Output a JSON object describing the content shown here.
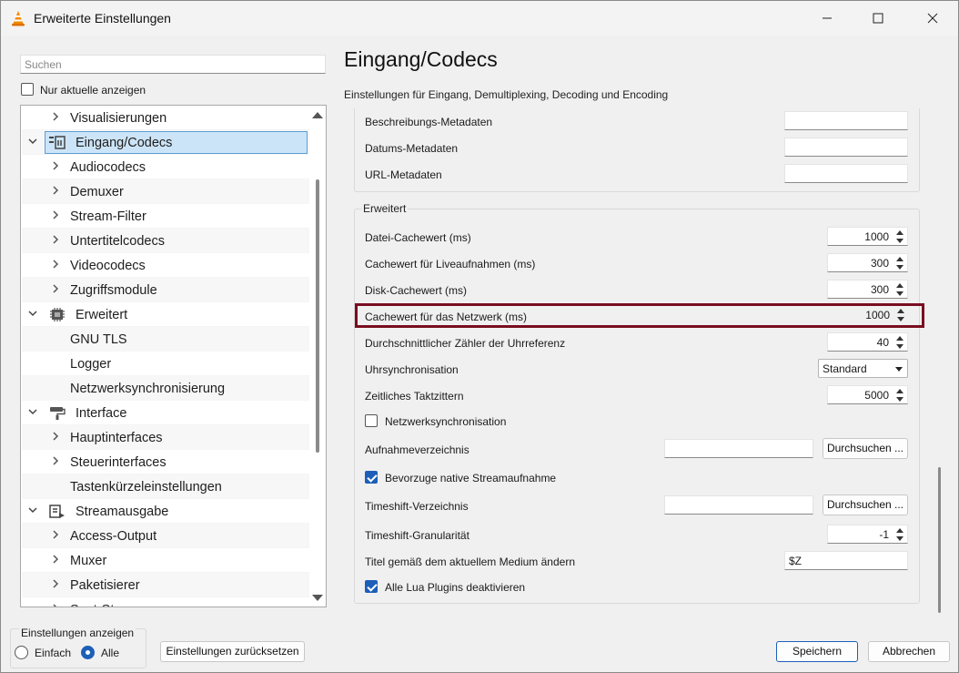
{
  "window": {
    "title": "Erweiterte Einstellungen"
  },
  "sidebar": {
    "search_placeholder": "Suchen",
    "only_current_label": "Nur aktuelle anzeigen",
    "only_current_checked": false,
    "tree": [
      {
        "label": "Visualisierungen",
        "level": 1,
        "expander": "collapsed"
      },
      {
        "label": "Eingang/Codecs",
        "level": 0,
        "expander": "expanded",
        "icon": "codec-icon",
        "selected": true
      },
      {
        "label": "Audiocodecs",
        "level": 1,
        "expander": "collapsed"
      },
      {
        "label": "Demuxer",
        "level": 1,
        "expander": "collapsed"
      },
      {
        "label": "Stream-Filter",
        "level": 1,
        "expander": "collapsed"
      },
      {
        "label": "Untertitelcodecs",
        "level": 1,
        "expander": "collapsed"
      },
      {
        "label": "Videocodecs",
        "level": 1,
        "expander": "collapsed"
      },
      {
        "label": "Zugriffsmodule",
        "level": 1,
        "expander": "collapsed"
      },
      {
        "label": "Erweitert",
        "level": 0,
        "expander": "expanded",
        "icon": "chip-icon"
      },
      {
        "label": "GNU TLS",
        "level": 1,
        "expander": "none"
      },
      {
        "label": "Logger",
        "level": 1,
        "expander": "none"
      },
      {
        "label": "Netzwerksynchronisierung",
        "level": 1,
        "expander": "none"
      },
      {
        "label": "Interface",
        "level": 0,
        "expander": "expanded",
        "icon": "paint-roller-icon"
      },
      {
        "label": "Hauptinterfaces",
        "level": 1,
        "expander": "collapsed"
      },
      {
        "label": "Steuerinterfaces",
        "level": 1,
        "expander": "collapsed"
      },
      {
        "label": "Tastenkürzeleinstellungen",
        "level": 1,
        "expander": "none"
      },
      {
        "label": "Streamausgabe",
        "level": 0,
        "expander": "expanded",
        "icon": "stream-output-icon"
      },
      {
        "label": "Access-Output",
        "level": 1,
        "expander": "collapsed"
      },
      {
        "label": "Muxer",
        "level": 1,
        "expander": "collapsed"
      },
      {
        "label": "Paketisierer",
        "level": 1,
        "expander": "collapsed"
      },
      {
        "label": "Sout-Stream",
        "level": 1,
        "expander": "collapsed"
      }
    ]
  },
  "main": {
    "title": "Eingang/Codecs",
    "description": "Einstellungen für Eingang, Demultiplexing, Decoding und Encoding",
    "metadata_rows": [
      {
        "label": "Beschreibungs-Metadaten",
        "value": ""
      },
      {
        "label": "Datums-Metadaten",
        "value": ""
      },
      {
        "label": "URL-Metadaten",
        "value": ""
      }
    ],
    "advanced_group_title": "Erweitert",
    "advanced": {
      "file_cache": {
        "label": "Datei-Cachewert (ms)",
        "value": "1000"
      },
      "live_cache": {
        "label": "Cachewert für Liveaufnahmen (ms)",
        "value": "300"
      },
      "disc_cache": {
        "label": "Disk-Cachewert (ms)",
        "value": "300"
      },
      "network_cache": {
        "label": "Cachewert für das Netzwerk (ms)",
        "value": "1000"
      },
      "clock_ref": {
        "label": "Durchschnittlicher Zähler der Uhrreferenz",
        "value": "40"
      },
      "clock_sync": {
        "label": "Uhrsynchronisation",
        "value": "Standard"
      },
      "clock_jitter": {
        "label": "Zeitliches Taktzittern",
        "value": "5000"
      },
      "netsync": {
        "label": "Netzwerksynchronisation",
        "checked": false
      },
      "record_dir": {
        "label": "Aufnahmeverzeichnis",
        "value": "",
        "browse": "Durchsuchen ..."
      },
      "native_record": {
        "label": "Bevorzuge native Streamaufnahme",
        "checked": true
      },
      "timeshift_dir": {
        "label": "Timeshift-Verzeichnis",
        "value": "",
        "browse": "Durchsuchen ..."
      },
      "timeshift_gran": {
        "label": "Timeshift-Granularität",
        "value": "-1"
      },
      "title_format": {
        "label": "Titel gemäß dem aktuellem Medium ändern",
        "value": "$Z"
      },
      "disable_lua": {
        "label": "Alle Lua Plugins deaktivieren",
        "checked": true
      }
    }
  },
  "footer": {
    "show_settings_title": "Einstellungen anzeigen",
    "simple_label": "Einfach",
    "all_label": "Alle",
    "selected_mode": "Alle",
    "reset_label": "Einstellungen zurücksetzen",
    "save_label": "Speichern",
    "cancel_label": "Abbrechen"
  },
  "colors": {
    "highlight_border": "#7a0d1f",
    "selection_bg": "#cce4f7",
    "accent": "#1d5fb8"
  }
}
